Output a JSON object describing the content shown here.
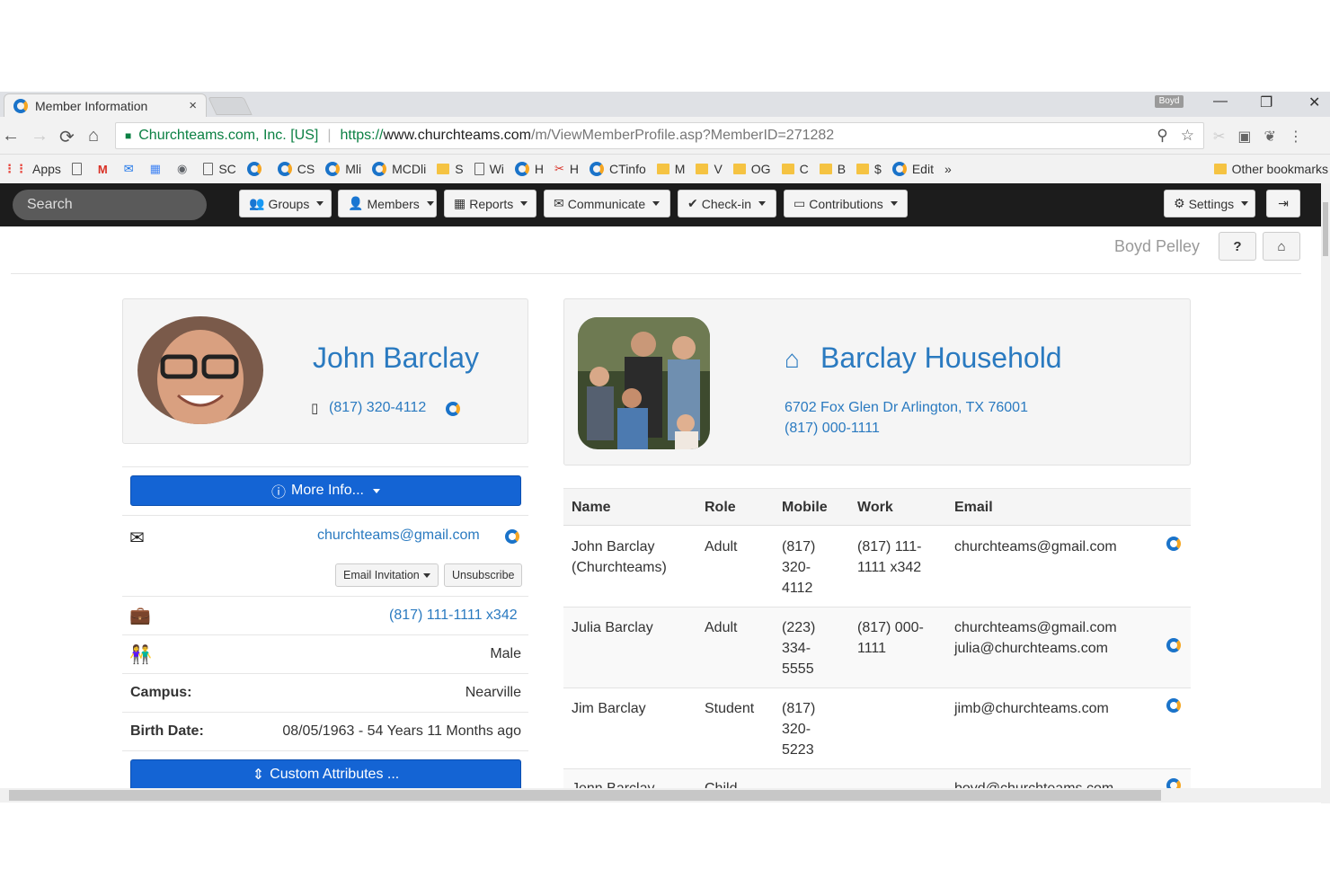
{
  "browser": {
    "tab_title": "Member Information",
    "tab_close": "×",
    "profile_chip": "Boyd",
    "window_controls": [
      "—",
      "❐",
      "✕"
    ],
    "address_org": "Churchteams.com, Inc. [US]",
    "url_proto": "https://",
    "url_host": "www.churchteams.com",
    "url_path": "/m/ViewMemberProfile.asp?MemberID=271282",
    "bookmarks": [
      {
        "label": "Apps",
        "icon": "apps-grid-icon"
      },
      {
        "label": "",
        "icon": "page-icon"
      },
      {
        "label": "",
        "icon": "gmail-icon"
      },
      {
        "label": "",
        "icon": "mail-icon"
      },
      {
        "label": "",
        "icon": "calendar-icon"
      },
      {
        "label": "",
        "icon": "globe-icon"
      },
      {
        "label": "SC",
        "icon": "page-icon"
      },
      {
        "label": "",
        "icon": "churchteams-icon"
      },
      {
        "label": "CS",
        "icon": "churchteams-icon"
      },
      {
        "label": "Mli",
        "icon": "churchteams-icon"
      },
      {
        "label": "MCDli",
        "icon": "churchteams-icon"
      },
      {
        "label": "S",
        "icon": "folder-icon"
      },
      {
        "label": "Wi",
        "icon": "page-icon"
      },
      {
        "label": "H",
        "icon": "churchteams-icon"
      },
      {
        "label": "H",
        "icon": "tool-icon"
      },
      {
        "label": "CTinfo",
        "icon": "churchteams-icon"
      },
      {
        "label": "M",
        "icon": "folder-icon"
      },
      {
        "label": "V",
        "icon": "folder-icon"
      },
      {
        "label": "OG",
        "icon": "folder-icon"
      },
      {
        "label": "C",
        "icon": "folder-icon"
      },
      {
        "label": "B",
        "icon": "folder-icon"
      },
      {
        "label": "$",
        "icon": "folder-icon"
      },
      {
        "label": "Edit",
        "icon": "churchteams-icon"
      },
      {
        "label": "»",
        "icon": ""
      },
      {
        "label": "Other bookmarks",
        "icon": "folder-icon"
      }
    ]
  },
  "nav": {
    "search_placeholder": "Search",
    "groups": "Groups",
    "members": "Members",
    "reports": "Reports",
    "communicate": "Communicate",
    "checkin": "Check-in",
    "contributions": "Contributions",
    "settings": "Settings"
  },
  "user": {
    "name": "Boyd Pelley"
  },
  "member": {
    "name": "John Barclay",
    "phone": "(817) 320-4112",
    "more_info": "More Info...",
    "email": "churchteams@gmail.com",
    "email_invitation": "Email Invitation",
    "unsubscribe": "Unsubscribe",
    "work_phone": "(817) 111-1111 x342",
    "gender": "Male",
    "campus_label": "Campus:",
    "campus": "Nearville",
    "birth_label": "Birth Date:",
    "birth": "08/05/1963 - 54 Years 11 Months ago",
    "custom_attributes": "Custom Attributes ..."
  },
  "household": {
    "title": "Barclay Household",
    "address": "6702 Fox Glen Dr Arlington, TX 76001",
    "phone": "(817) 000-1111",
    "columns": [
      "Name",
      "Role",
      "Mobile",
      "Work",
      "Email"
    ],
    "rows": [
      {
        "name1": "John Barclay",
        "name2": "(Churchteams)",
        "role": "Adult",
        "mobile": [
          "(817)",
          "320-",
          "4112"
        ],
        "work": [
          "(817) 111-",
          "1111 x342"
        ],
        "email1": "churchteams@gmail.com",
        "email2": ""
      },
      {
        "name1": "Julia Barclay",
        "name2": "",
        "role": "Adult",
        "mobile": [
          "(223)",
          "334-",
          "5555"
        ],
        "work": [
          "(817) 000-",
          "1111"
        ],
        "email1": "churchteams@gmail.com",
        "email2": "julia@churchteams.com"
      },
      {
        "name1": "Jim Barclay",
        "name2": "",
        "role": "Student",
        "mobile": [
          "(817)",
          "320-",
          "5223"
        ],
        "work": [
          "",
          ""
        ],
        "email1": "jimb@churchteams.com",
        "email2": ""
      },
      {
        "name1": "Jenn Barclay",
        "name2": "",
        "role": "Child",
        "mobile": [
          "",
          "",
          ""
        ],
        "work": [
          "",
          ""
        ],
        "email1": "boyd@churchteams.com",
        "email2": ""
      }
    ]
  },
  "colors": {
    "link": "#2a7ac0",
    "primary_button": "#1464d4",
    "navbar": "#1c1c1c",
    "logo_blue": "#1a73c9",
    "logo_orange": "#f5a623"
  }
}
